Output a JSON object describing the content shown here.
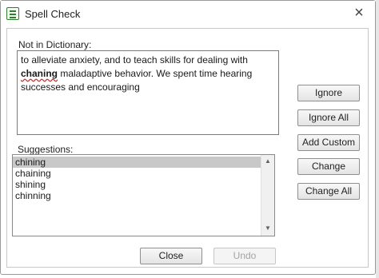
{
  "dialog": {
    "title": "Spell Check",
    "close_glyph": "×",
    "icon": "spell-check-icon"
  },
  "not_in_dictionary": {
    "label": "Not in Dictionary:",
    "text_before": "to alleviate anxiety, and to teach skills for dealing with ",
    "misspelled_word": "chaning",
    "text_after": " maladaptive behavior. We spent time hearing successes and encouraging"
  },
  "suggestions": {
    "label": "Suggestions:",
    "items": [
      "chining",
      "chaining",
      "shining",
      "chinning"
    ],
    "selected_index": 0
  },
  "actions": {
    "ignore": "Ignore",
    "ignore_all": "Ignore All",
    "add_custom": "Add Custom",
    "change": "Change",
    "change_all": "Change All"
  },
  "footer": {
    "close": "Close",
    "undo": "Undo"
  },
  "colors": {
    "selection": "#c8c8c8",
    "misspelling_underline": "#dd2222",
    "icon_green": "#2f7d2f"
  }
}
